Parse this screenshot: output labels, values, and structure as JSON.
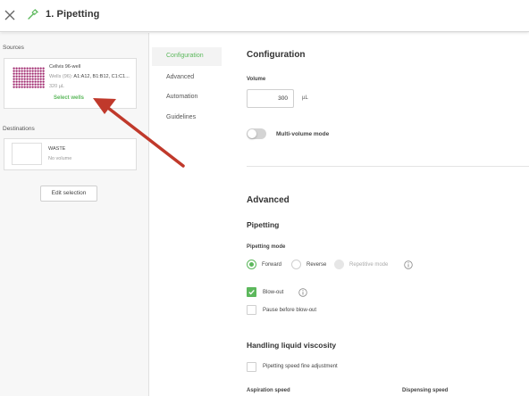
{
  "header": {
    "title": "1. Pipetting",
    "close_icon": "close-icon",
    "step_icon": "pipette-icon"
  },
  "sidebar": {
    "sources_label": "Sources",
    "source": {
      "name": "Cellvis 96-well",
      "wells_prefix": "Wells (96):",
      "wells_value": "A1:A12, B1:B12, C1:C1...",
      "volume": "320 µL",
      "select_wells": "Select wells"
    },
    "destinations_label": "Destinations",
    "destination": {
      "name": "WASTE",
      "volume": "No volume"
    },
    "edit_selection": "Edit selection"
  },
  "tabs": [
    {
      "label": "Configuration",
      "active": true
    },
    {
      "label": "Advanced",
      "active": false
    },
    {
      "label": "Automation",
      "active": false
    },
    {
      "label": "Guidelines",
      "active": false
    }
  ],
  "configuration": {
    "heading": "Configuration",
    "volume_label": "Volume",
    "volume_value": "300",
    "volume_unit": "µL",
    "multi_volume_label": "Multi-volume mode",
    "multi_volume_on": false
  },
  "advanced": {
    "heading": "Advanced",
    "pipetting_heading": "Pipetting",
    "pipetting_mode_label": "Pipetting mode",
    "modes": [
      {
        "label": "Forward",
        "selected": true,
        "disabled": false
      },
      {
        "label": "Reverse",
        "selected": false,
        "disabled": false
      },
      {
        "label": "Repetitive mode",
        "selected": false,
        "disabled": true
      }
    ],
    "blowout_label": "Blow-out",
    "blowout_checked": true,
    "pause_label": "Pause before blow-out",
    "pause_checked": false,
    "viscosity_heading": "Handling liquid viscosity",
    "fine_adjust_label": "Pipetting speed fine adjustment",
    "fine_adjust_checked": false,
    "aspiration_label": "Aspiration speed",
    "dispensing_label": "Dispensing speed"
  },
  "colors": {
    "accent": "#5cb85c",
    "annotation_arrow": "#c0392b",
    "plate_wells": "#a0286e"
  }
}
